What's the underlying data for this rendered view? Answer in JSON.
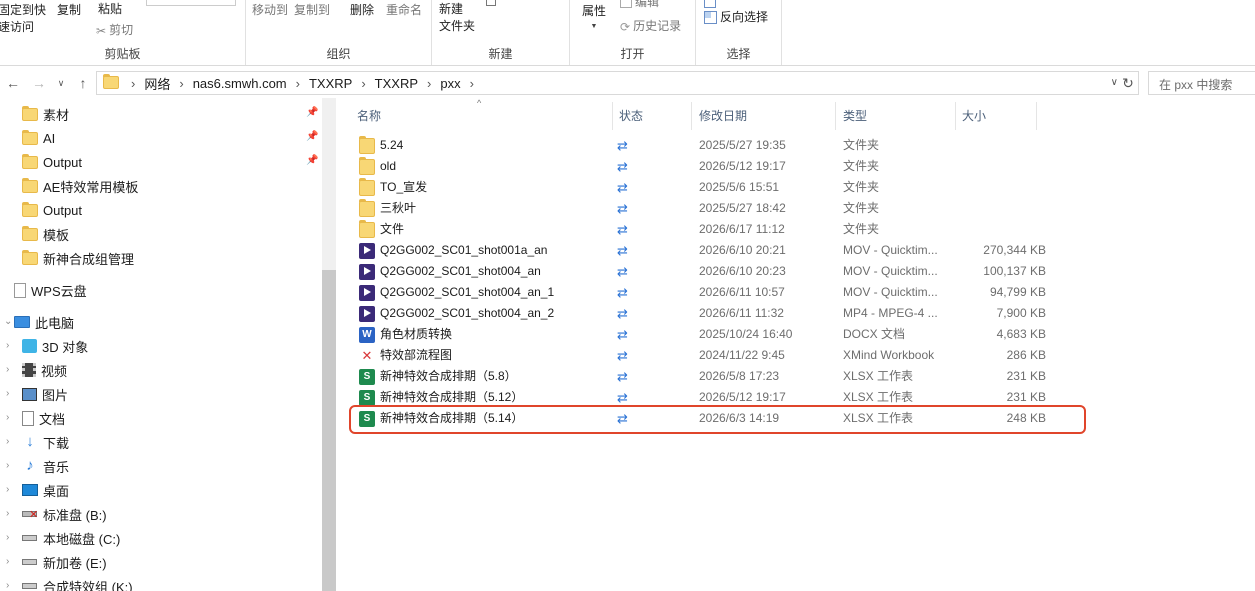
{
  "ribbon": {
    "clipboard": {
      "pin_quick_access": "固定到快\n速访问",
      "copy": "复制",
      "paste": "粘贴",
      "cut": "剪切",
      "group_label": "剪贴板"
    },
    "organize": {
      "move_to": "移动到",
      "copy_to": "复制到",
      "delete": "删除",
      "rename": "重命名",
      "group_label": "组织"
    },
    "new": {
      "new_folder": "新建\n文件夹",
      "group_label": "新建"
    },
    "open": {
      "properties": "属性",
      "edit": "编辑",
      "history": "历史记录",
      "group_label": "打开"
    },
    "select": {
      "invert_selection": "反向选择",
      "group_label": "选择"
    }
  },
  "address": {
    "crumbs": [
      "网络",
      "nas6.smwh.com",
      "TXXRP",
      "TXXRP",
      "pxx"
    ],
    "search_placeholder": "在 pxx 中搜索"
  },
  "nav": {
    "quick_access": [
      {
        "label": "素材",
        "pinned": true
      },
      {
        "label": "AI",
        "pinned": true
      },
      {
        "label": "Output",
        "pinned": true
      },
      {
        "label": "AE特效常用模板",
        "pinned": false
      },
      {
        "label": "Output",
        "pinned": false
      },
      {
        "label": "模板",
        "pinned": false
      },
      {
        "label": "新神合成组管理",
        "pinned": false
      }
    ],
    "wps": "WPS云盘",
    "this_pc": "此电脑",
    "pc_items": [
      {
        "label": "3D 对象",
        "icon": "3d-objects-icon"
      },
      {
        "label": "视频",
        "icon": "videos-icon"
      },
      {
        "label": "图片",
        "icon": "pictures-icon"
      },
      {
        "label": "文档",
        "icon": "documents-icon"
      },
      {
        "label": "下载",
        "icon": "downloads-icon"
      },
      {
        "label": "音乐",
        "icon": "music-icon"
      },
      {
        "label": "桌面",
        "icon": "desktop-icon"
      },
      {
        "label": "标准盘 (B:)",
        "icon": "network-drive-disconnected-icon"
      },
      {
        "label": "本地磁盘 (C:)",
        "icon": "local-disk-icon"
      },
      {
        "label": "新加卷 (E:)",
        "icon": "local-disk-icon"
      },
      {
        "label": "合成特效组 (K:)",
        "icon": "network-drive-icon"
      }
    ]
  },
  "columns": {
    "name": "名称",
    "status": "状态",
    "modified": "修改日期",
    "type": "类型",
    "size": "大小"
  },
  "files": [
    {
      "name": "5.24",
      "icon": "folder",
      "modified": "2025/5/27 19:35",
      "type": "文件夹",
      "size": ""
    },
    {
      "name": "old",
      "icon": "folder",
      "modified": "2026/5/12 19:17",
      "type": "文件夹",
      "size": ""
    },
    {
      "name": "TO_宣发",
      "icon": "folder",
      "modified": "2025/5/6 15:51",
      "type": "文件夹",
      "size": ""
    },
    {
      "name": "三秋叶",
      "icon": "folder",
      "modified": "2025/5/27 18:42",
      "type": "文件夹",
      "size": ""
    },
    {
      "name": "文件",
      "icon": "folder",
      "modified": "2026/6/17 11:12",
      "type": "文件夹",
      "size": ""
    },
    {
      "name": "Q2GG002_SC01_shot001a_an",
      "icon": "mov",
      "modified": "2026/6/10 20:21",
      "type": "MOV - Quicktim...",
      "size": "270,344 KB"
    },
    {
      "name": "Q2GG002_SC01_shot004_an",
      "icon": "mov",
      "modified": "2026/6/10 20:23",
      "type": "MOV - Quicktim...",
      "size": "100,137 KB"
    },
    {
      "name": "Q2GG002_SC01_shot004_an_1",
      "icon": "mov",
      "modified": "2026/6/11 10:57",
      "type": "MOV - Quicktim...",
      "size": "94,799 KB"
    },
    {
      "name": "Q2GG002_SC01_shot004_an_2",
      "icon": "mp4",
      "modified": "2026/6/11 11:32",
      "type": "MP4 - MPEG-4 ...",
      "size": "7,900 KB"
    },
    {
      "name": "角色材质转换",
      "icon": "docx",
      "modified": "2025/10/24 16:40",
      "type": "DOCX 文档",
      "size": "4,683 KB"
    },
    {
      "name": "特效部流程图",
      "icon": "xmind",
      "modified": "2024/11/22 9:45",
      "type": "XMind Workbook",
      "size": "286 KB"
    },
    {
      "name": "新神特效合成排期（5.8）",
      "icon": "xlsx",
      "modified": "2026/5/8 17:23",
      "type": "XLSX 工作表",
      "size": "231 KB"
    },
    {
      "name": "新神特效合成排期（5.12）",
      "icon": "xlsx",
      "modified": "2026/5/12 19:17",
      "type": "XLSX 工作表",
      "size": "231 KB"
    },
    {
      "name": "新神特效合成排期（5.14）",
      "icon": "xlsx",
      "modified": "2026/6/3 14:19",
      "type": "XLSX 工作表",
      "size": "248 KB"
    }
  ],
  "colors": {
    "highlight_border": "#e0452b",
    "sync_icon": "#2a72d5",
    "folder_yellow": "#f8d775"
  }
}
